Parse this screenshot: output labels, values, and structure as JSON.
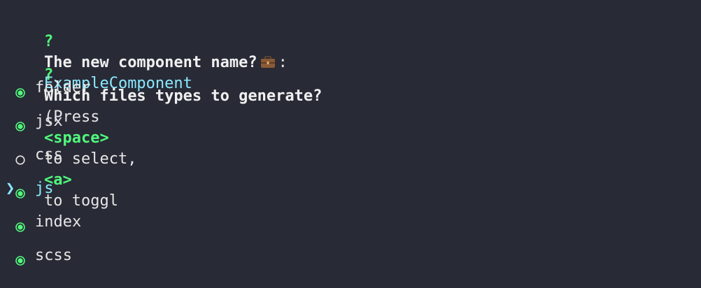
{
  "prompt1": {
    "marker": "?",
    "question": "The new component name?",
    "icon": "briefcase-icon",
    "separator": ":",
    "answer": "ExampleComponent"
  },
  "prompt2": {
    "marker": "?",
    "question": "Which files types to generate?",
    "hint_open": "(Press",
    "key_space": "<space>",
    "hint_mid": "to select,",
    "key_a": "<a>",
    "hint_end": "to toggl"
  },
  "options": [
    {
      "label": "folder",
      "checked": true,
      "active": false
    },
    {
      "label": "jsx",
      "checked": true,
      "active": false
    },
    {
      "label": "css",
      "checked": false,
      "active": false
    },
    {
      "label": "js",
      "checked": true,
      "active": true
    },
    {
      "label": "index",
      "checked": true,
      "active": false
    },
    {
      "label": "scss",
      "checked": true,
      "active": false
    }
  ],
  "pointer_glyph": "❯",
  "colors": {
    "background": "#282a36",
    "accent_green": "#50fa7b",
    "accent_cyan": "#8be9fd",
    "text": "#e6e6e6"
  }
}
